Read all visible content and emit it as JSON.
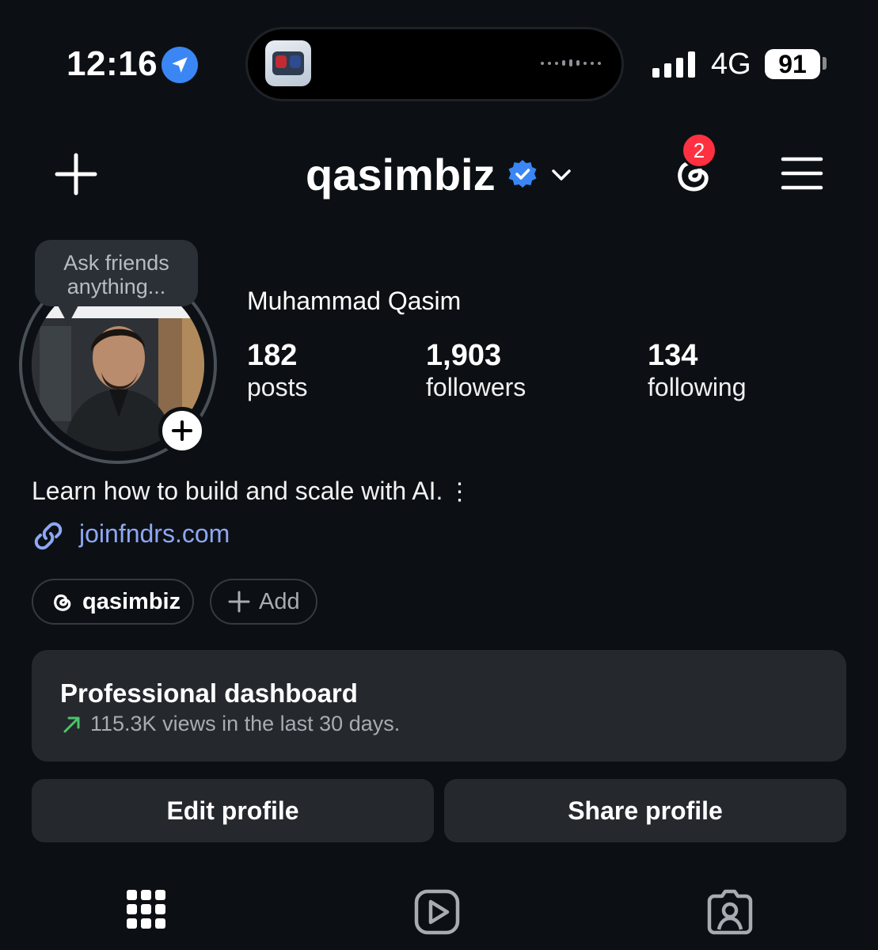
{
  "status_bar": {
    "time": "12:16",
    "network": "4G",
    "battery": "91",
    "location_icon": "location-arrow-icon",
    "island_app_icon": "escape-pod-app-icon"
  },
  "header": {
    "username": "qasimbiz",
    "verified_icon": "verified-badge-icon",
    "notification_count": "2",
    "accent_color": "#3a86f5",
    "badge_color": "#ff3040"
  },
  "profile": {
    "note_bubble": "Ask friends anything...",
    "full_name": "Muhammad Qasim",
    "stats": [
      {
        "value": "182",
        "label": "posts"
      },
      {
        "value": "1,903",
        "label": "followers"
      },
      {
        "value": "134",
        "label": "following"
      }
    ],
    "bio": "Learn how to build and scale with AI.",
    "link": "joinfndrs.com",
    "link_color": "#8ea7f5"
  },
  "chips": {
    "threads_handle": "qasimbiz",
    "add_label": "Add"
  },
  "dashboard": {
    "title": "Professional dashboard",
    "subtitle": "115.3K views in the last 30 days.",
    "trend_color": "#4cc46b"
  },
  "actions": {
    "edit_label": "Edit profile",
    "share_label": "Share profile"
  },
  "tabs": [
    {
      "icon": "grid-icon"
    },
    {
      "icon": "reels-icon"
    },
    {
      "icon": "tagged-icon"
    }
  ]
}
